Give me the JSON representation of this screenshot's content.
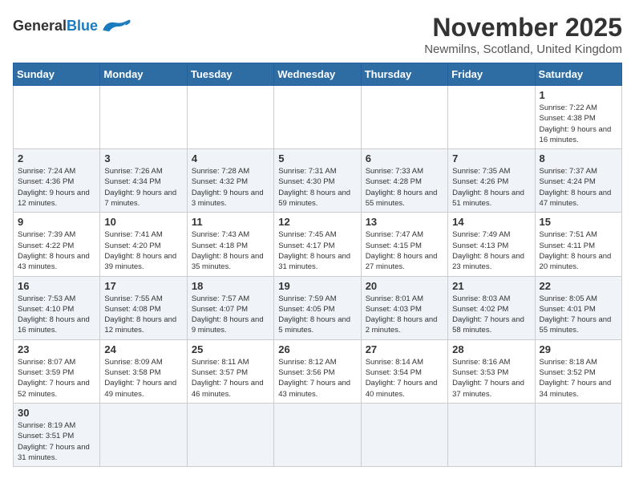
{
  "header": {
    "logo_general": "General",
    "logo_blue": "Blue",
    "month": "November 2025",
    "location": "Newmilns, Scotland, United Kingdom"
  },
  "weekdays": [
    "Sunday",
    "Monday",
    "Tuesday",
    "Wednesday",
    "Thursday",
    "Friday",
    "Saturday"
  ],
  "weeks": [
    [
      {
        "day": "",
        "info": ""
      },
      {
        "day": "",
        "info": ""
      },
      {
        "day": "",
        "info": ""
      },
      {
        "day": "",
        "info": ""
      },
      {
        "day": "",
        "info": ""
      },
      {
        "day": "",
        "info": ""
      },
      {
        "day": "1",
        "info": "Sunrise: 7:22 AM\nSunset: 4:38 PM\nDaylight: 9 hours\nand 16 minutes."
      }
    ],
    [
      {
        "day": "2",
        "info": "Sunrise: 7:24 AM\nSunset: 4:36 PM\nDaylight: 9 hours\nand 12 minutes."
      },
      {
        "day": "3",
        "info": "Sunrise: 7:26 AM\nSunset: 4:34 PM\nDaylight: 9 hours\nand 7 minutes."
      },
      {
        "day": "4",
        "info": "Sunrise: 7:28 AM\nSunset: 4:32 PM\nDaylight: 9 hours\nand 3 minutes."
      },
      {
        "day": "5",
        "info": "Sunrise: 7:31 AM\nSunset: 4:30 PM\nDaylight: 8 hours\nand 59 minutes."
      },
      {
        "day": "6",
        "info": "Sunrise: 7:33 AM\nSunset: 4:28 PM\nDaylight: 8 hours\nand 55 minutes."
      },
      {
        "day": "7",
        "info": "Sunrise: 7:35 AM\nSunset: 4:26 PM\nDaylight: 8 hours\nand 51 minutes."
      },
      {
        "day": "8",
        "info": "Sunrise: 7:37 AM\nSunset: 4:24 PM\nDaylight: 8 hours\nand 47 minutes."
      }
    ],
    [
      {
        "day": "9",
        "info": "Sunrise: 7:39 AM\nSunset: 4:22 PM\nDaylight: 8 hours\nand 43 minutes."
      },
      {
        "day": "10",
        "info": "Sunrise: 7:41 AM\nSunset: 4:20 PM\nDaylight: 8 hours\nand 39 minutes."
      },
      {
        "day": "11",
        "info": "Sunrise: 7:43 AM\nSunset: 4:18 PM\nDaylight: 8 hours\nand 35 minutes."
      },
      {
        "day": "12",
        "info": "Sunrise: 7:45 AM\nSunset: 4:17 PM\nDaylight: 8 hours\nand 31 minutes."
      },
      {
        "day": "13",
        "info": "Sunrise: 7:47 AM\nSunset: 4:15 PM\nDaylight: 8 hours\nand 27 minutes."
      },
      {
        "day": "14",
        "info": "Sunrise: 7:49 AM\nSunset: 4:13 PM\nDaylight: 8 hours\nand 23 minutes."
      },
      {
        "day": "15",
        "info": "Sunrise: 7:51 AM\nSunset: 4:11 PM\nDaylight: 8 hours\nand 20 minutes."
      }
    ],
    [
      {
        "day": "16",
        "info": "Sunrise: 7:53 AM\nSunset: 4:10 PM\nDaylight: 8 hours\nand 16 minutes."
      },
      {
        "day": "17",
        "info": "Sunrise: 7:55 AM\nSunset: 4:08 PM\nDaylight: 8 hours\nand 12 minutes."
      },
      {
        "day": "18",
        "info": "Sunrise: 7:57 AM\nSunset: 4:07 PM\nDaylight: 8 hours\nand 9 minutes."
      },
      {
        "day": "19",
        "info": "Sunrise: 7:59 AM\nSunset: 4:05 PM\nDaylight: 8 hours\nand 5 minutes."
      },
      {
        "day": "20",
        "info": "Sunrise: 8:01 AM\nSunset: 4:03 PM\nDaylight: 8 hours\nand 2 minutes."
      },
      {
        "day": "21",
        "info": "Sunrise: 8:03 AM\nSunset: 4:02 PM\nDaylight: 7 hours\nand 58 minutes."
      },
      {
        "day": "22",
        "info": "Sunrise: 8:05 AM\nSunset: 4:01 PM\nDaylight: 7 hours\nand 55 minutes."
      }
    ],
    [
      {
        "day": "23",
        "info": "Sunrise: 8:07 AM\nSunset: 3:59 PM\nDaylight: 7 hours\nand 52 minutes."
      },
      {
        "day": "24",
        "info": "Sunrise: 8:09 AM\nSunset: 3:58 PM\nDaylight: 7 hours\nand 49 minutes."
      },
      {
        "day": "25",
        "info": "Sunrise: 8:11 AM\nSunset: 3:57 PM\nDaylight: 7 hours\nand 46 minutes."
      },
      {
        "day": "26",
        "info": "Sunrise: 8:12 AM\nSunset: 3:56 PM\nDaylight: 7 hours\nand 43 minutes."
      },
      {
        "day": "27",
        "info": "Sunrise: 8:14 AM\nSunset: 3:54 PM\nDaylight: 7 hours\nand 40 minutes."
      },
      {
        "day": "28",
        "info": "Sunrise: 8:16 AM\nSunset: 3:53 PM\nDaylight: 7 hours\nand 37 minutes."
      },
      {
        "day": "29",
        "info": "Sunrise: 8:18 AM\nSunset: 3:52 PM\nDaylight: 7 hours\nand 34 minutes."
      }
    ],
    [
      {
        "day": "30",
        "info": "Sunrise: 8:19 AM\nSunset: 3:51 PM\nDaylight: 7 hours\nand 31 minutes."
      },
      {
        "day": "",
        "info": ""
      },
      {
        "day": "",
        "info": ""
      },
      {
        "day": "",
        "info": ""
      },
      {
        "day": "",
        "info": ""
      },
      {
        "day": "",
        "info": ""
      },
      {
        "day": "",
        "info": ""
      }
    ]
  ]
}
